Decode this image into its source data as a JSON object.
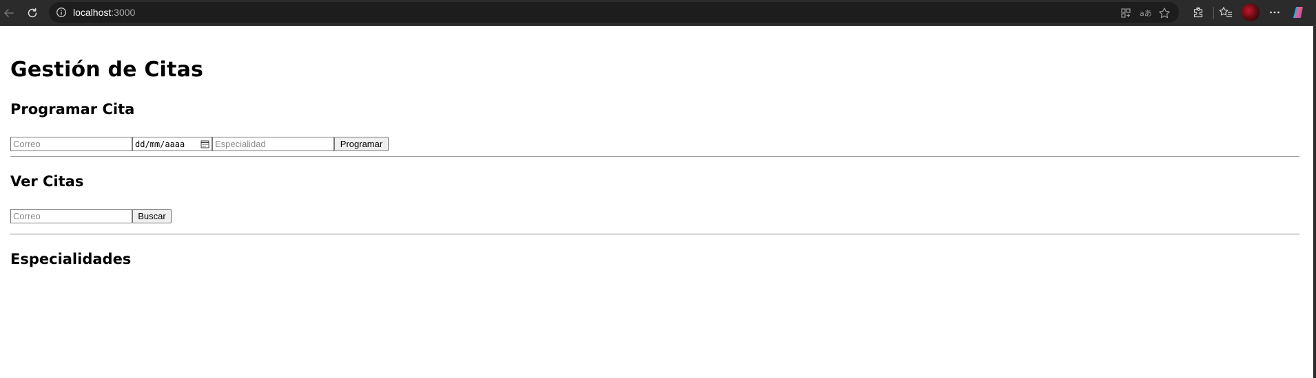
{
  "browser": {
    "url_host": "localhost",
    "url_port": ":3000"
  },
  "page": {
    "title": "Gestión de Citas",
    "schedule": {
      "heading": "Programar Cita",
      "email_placeholder": "Correo",
      "date_placeholder": "dd/mm/aaaa",
      "specialty_placeholder": "Especialidad",
      "submit_label": "Programar"
    },
    "view": {
      "heading": "Ver Citas",
      "email_placeholder": "Correo",
      "search_label": "Buscar"
    },
    "specialties": {
      "heading": "Especialidades"
    }
  }
}
